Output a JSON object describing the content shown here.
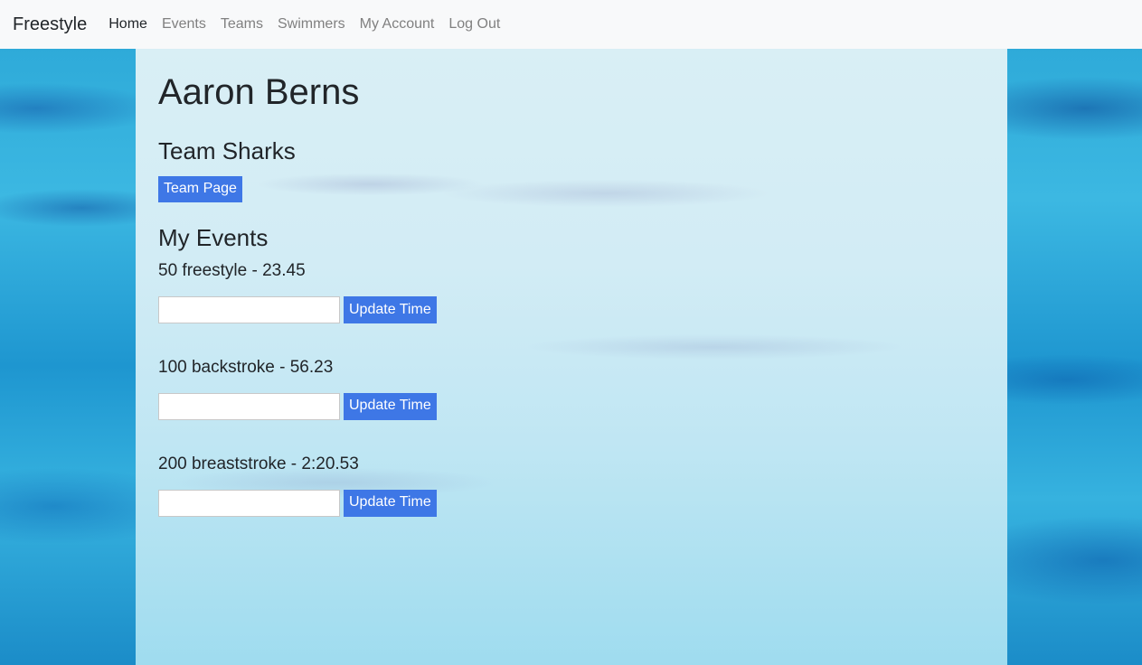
{
  "navbar": {
    "brand": "Freestyle",
    "links": [
      {
        "label": "Home",
        "active": true
      },
      {
        "label": "Events",
        "active": false
      },
      {
        "label": "Teams",
        "active": false
      },
      {
        "label": "Swimmers",
        "active": false
      },
      {
        "label": "My Account",
        "active": false
      },
      {
        "label": "Log Out",
        "active": false
      }
    ]
  },
  "swimmer": {
    "name": "Aaron Berns",
    "team_name": "Team Sharks",
    "team_page_label": "Team Page"
  },
  "events_section": {
    "title": "My Events",
    "events": [
      {
        "label": "50 freestyle - 23.45",
        "input_value": "",
        "button_label": "Update Time"
      },
      {
        "label": "100 backstroke - 56.23",
        "input_value": "",
        "button_label": "Update Time"
      },
      {
        "label": "200 breaststroke - 2:20.53",
        "input_value": "",
        "button_label": "Update Time"
      }
    ]
  },
  "colors": {
    "primary_button": "#3e77e6",
    "navbar_bg": "#f8f9fa"
  }
}
